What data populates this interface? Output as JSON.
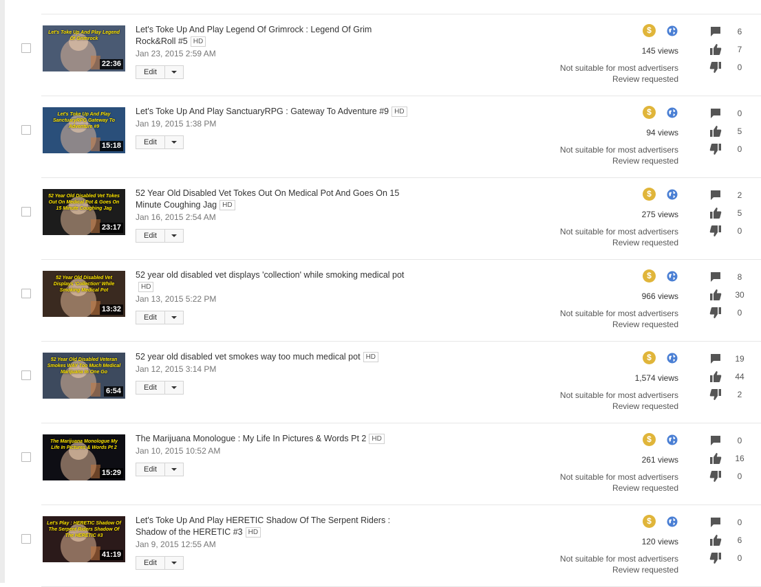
{
  "videos": [
    {
      "title": "Let's Toke Up And Play Legend Of Grimrock : Legend Of Grim Rock&Roll #5",
      "hd": "HD",
      "date": "Jan 23, 2015 2:59 AM",
      "duration": "22:36",
      "thumb_caption": "Let's Toke Up And Play Legend Of Grimrock",
      "thumb_bg": "#4a5a73",
      "views": "145 views",
      "ads_status": "Not suitable for most advertisers",
      "review": "Review requested",
      "comments": "6",
      "likes": "7",
      "dislikes": "0",
      "edit_label": "Edit"
    },
    {
      "title": "Let's Toke Up And Play SanctuaryRPG : Gateway To Adventure #9",
      "hd": "HD",
      "date": "Jan 19, 2015 1:38 PM",
      "duration": "15:18",
      "thumb_caption": "Let's Toke Up And Play SanctuaryRPG Gateway To Adventure #9",
      "thumb_bg": "#2a4f7a",
      "views": "94 views",
      "ads_status": "Not suitable for most advertisers",
      "review": "Review requested",
      "comments": "0",
      "likes": "5",
      "dislikes": "0",
      "edit_label": "Edit"
    },
    {
      "title": "52 Year Old Disabled Vet Tokes Out On Medical Pot And Goes On 15 Minute Coughing Jag",
      "hd": "HD",
      "date": "Jan 16, 2015 2:54 AM",
      "duration": "23:17",
      "thumb_caption": "52 Year Old Disabled Vet Tokes Out On Medical Pot & Goes On 15 Minute Coughing Jag",
      "thumb_bg": "#1c1c1c",
      "views": "275 views",
      "ads_status": "Not suitable for most advertisers",
      "review": "Review requested",
      "comments": "2",
      "likes": "5",
      "dislikes": "0",
      "edit_label": "Edit"
    },
    {
      "title": "52 year old disabled vet displays 'collection' while smoking medical pot",
      "hd": "HD",
      "date": "Jan 13, 2015 5:22 PM",
      "duration": "13:32",
      "thumb_caption": "52 Year Old Disabled Vet Displays 'Collection' While Smoking Medical Pot",
      "thumb_bg": "#3a2a20",
      "views": "966 views",
      "ads_status": "Not suitable for most advertisers",
      "review": "Review requested",
      "comments": "8",
      "likes": "30",
      "dislikes": "0",
      "edit_label": "Edit"
    },
    {
      "title": "52 year old disabled vet smokes way too much medical pot",
      "hd": "HD",
      "date": "Jan 12, 2015 3:14 PM",
      "duration": "6:54",
      "thumb_caption": "52 Year Old Disabled Veteran Smokes WAY Too Much Medical Marijuana In One Go",
      "thumb_bg": "#3d4a5e",
      "views": "1,574 views",
      "ads_status": "Not suitable for most advertisers",
      "review": "Review requested",
      "comments": "19",
      "likes": "44",
      "dislikes": "2",
      "edit_label": "Edit"
    },
    {
      "title": "The Marijuana Monologue : My Life In Pictures & Words Pt 2",
      "hd": "HD",
      "date": "Jan 10, 2015 10:52 AM",
      "duration": "15:29",
      "thumb_caption": "The Marijuana Monologue My Life In Pictures & Words Pt 2",
      "thumb_bg": "#0e0e14",
      "views": "261 views",
      "ads_status": "Not suitable for most advertisers",
      "review": "Review requested",
      "comments": "0",
      "likes": "16",
      "dislikes": "0",
      "edit_label": "Edit"
    },
    {
      "title": "Let's Toke Up And Play HERETIC Shadow Of The Serpent Riders : Shadow of the HERETIC #3",
      "hd": "HD",
      "date": "Jan 9, 2015 12:55 AM",
      "duration": "41:19",
      "thumb_caption": "Let's Play : HERETIC Shadow Of The Serpent Riders Shadow Of The HERETIC #3",
      "thumb_bg": "#2b1a1a",
      "views": "120 views",
      "ads_status": "Not suitable for most advertisers",
      "review": "Review requested",
      "comments": "0",
      "likes": "6",
      "dislikes": "0",
      "edit_label": "Edit"
    }
  ],
  "icons": {
    "monetization": "dollar-icon",
    "visibility": "globe-icon",
    "comments": "comment-icon",
    "likes": "thumbs-up-icon",
    "dislikes": "thumbs-down-icon"
  },
  "colors": {
    "monetization_yellow": "#e0b53a",
    "public_blue": "#4a7fd4",
    "stat_icon": "#555555"
  }
}
